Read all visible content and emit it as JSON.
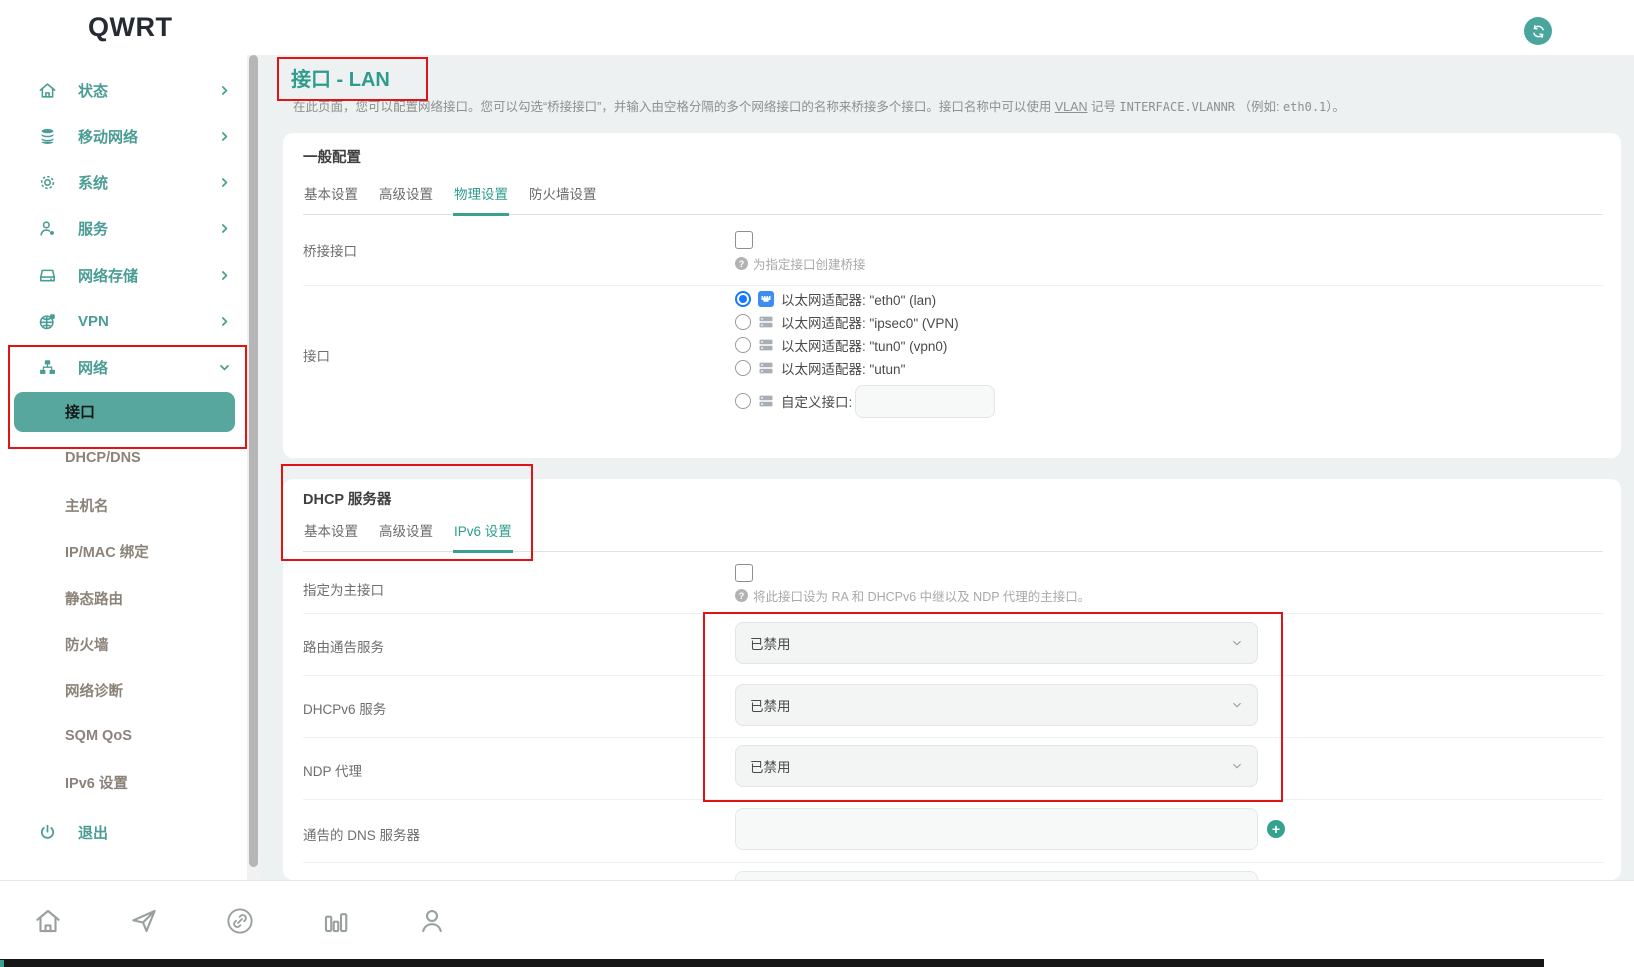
{
  "header": {
    "logo": "QWRT",
    "refresh_icon": "refresh"
  },
  "colors": {
    "teal_accent": "#3AA08F",
    "sidebar_teal": "#4A9D94",
    "active_item_bg": "#57A79E",
    "annotation_red": "#E01414",
    "radio_selected_blue": "#1677FF",
    "adapter_icon_blue": "#3E8EF0",
    "main_bg": "#EDF1F1"
  },
  "icons": {
    "help_glyph": "?",
    "plus_glyph": "+"
  },
  "sidebar": {
    "items": [
      {
        "label": "状态",
        "icon": "home"
      },
      {
        "label": "移动网络",
        "icon": "database"
      },
      {
        "label": "系统",
        "icon": "gear"
      },
      {
        "label": "服务",
        "icon": "user-gear"
      },
      {
        "label": "网络存储",
        "icon": "drive"
      },
      {
        "label": "VPN",
        "icon": "globe"
      },
      {
        "label": "网络",
        "icon": "network-tree",
        "expanded": true
      }
    ],
    "active_subitem": "接口",
    "subitems": [
      {
        "label": "DHCP/DNS"
      },
      {
        "label": "主机名"
      },
      {
        "label": "IP/MAC 绑定"
      },
      {
        "label": "静态路由"
      },
      {
        "label": "防火墙"
      },
      {
        "label": "网络诊断"
      },
      {
        "label": "SQM QoS"
      },
      {
        "label": "IPv6 设置"
      }
    ],
    "logout": {
      "label": "退出",
      "icon": "power"
    }
  },
  "page": {
    "title": "接口 - LAN",
    "desc_part1": "在此页面，您可以配置网络接口。您可以勾选“桥接接口”，并输入由空格分隔的多个网络接口的名称来桥接多个接口。接口名称中可以使用 ",
    "desc_vlan_link": "VLAN",
    "desc_part2": " 记号 ",
    "desc_code1": "INTERFACE.VLANNR",
    "desc_part3": " （例如: ",
    "desc_code2": "eth0.1",
    "desc_part4": "）。"
  },
  "general_card": {
    "title": "一般配置",
    "tabs": [
      {
        "label": "基本设置",
        "active": false
      },
      {
        "label": "高级设置",
        "active": false
      },
      {
        "label": "物理设置",
        "active": true
      },
      {
        "label": "防火墙设置",
        "active": false
      }
    ],
    "bridge": {
      "label": "桥接接口",
      "checked": false,
      "help": "为指定接口创建桥接"
    },
    "interface": {
      "label": "接口",
      "options": [
        {
          "label": "以太网适配器: \"eth0\" (lan)",
          "selected": true,
          "icon": "ethernet-adapter-blue"
        },
        {
          "label": "以太网适配器: \"ipsec0\" (VPN)",
          "selected": false,
          "icon": "adapter-gray"
        },
        {
          "label": "以太网适配器: \"tun0\" (vpn0)",
          "selected": false,
          "icon": "adapter-gray"
        },
        {
          "label": "以太网适配器: \"utun\"",
          "selected": false,
          "icon": "adapter-gray"
        },
        {
          "label": "自定义接口:",
          "selected": false,
          "icon": "adapter-gray",
          "input_value": ""
        }
      ]
    }
  },
  "dhcp_card": {
    "title": "DHCP 服务器",
    "tabs": [
      {
        "label": "基本设置",
        "active": false
      },
      {
        "label": "高级设置",
        "active": false
      },
      {
        "label": "IPv6 设置",
        "active": true
      }
    ],
    "master": {
      "label": "指定为主接口",
      "checked": false,
      "help": "将此接口设为 RA 和 DHCPv6 中继以及 NDP 代理的主接口。"
    },
    "ra_service": {
      "label": "路由通告服务",
      "value": "已禁用"
    },
    "dhcpv6_service": {
      "label": "DHCPv6 服务",
      "value": "已禁用"
    },
    "ndp_proxy": {
      "label": "NDP 代理",
      "value": "已禁用"
    },
    "announced_dns": {
      "label": "通告的 DNS 服务器",
      "value": ""
    }
  },
  "bottom_bar": {
    "icons": [
      "home",
      "send",
      "link",
      "bar-chart",
      "person"
    ]
  }
}
